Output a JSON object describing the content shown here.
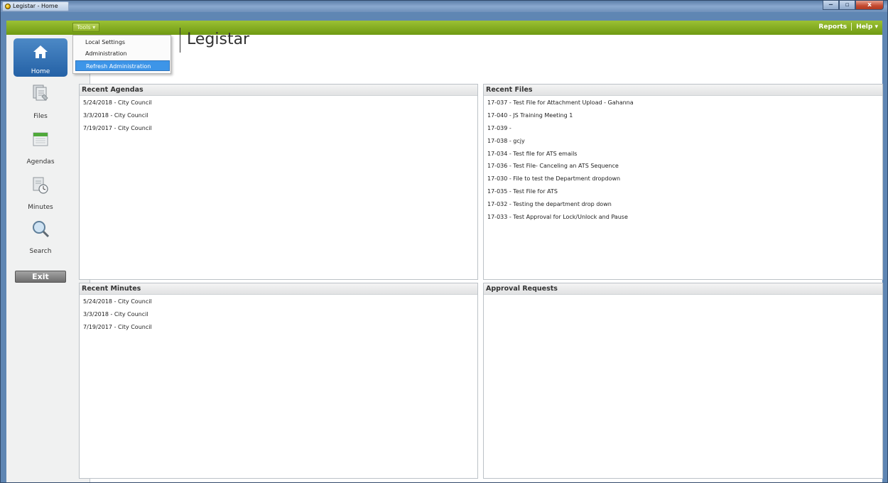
{
  "window": {
    "title": "Legistar - Home",
    "controls": {
      "minimize": "‒",
      "maximize": "▫",
      "close": "x"
    }
  },
  "menubar": {
    "tools_label": "Tools ▾",
    "reports_label": "Reports",
    "help_label": "Help ▾"
  },
  "tools_menu": {
    "items": [
      "Local Settings",
      "Administration",
      "Refresh Administration"
    ],
    "highlighted": "Refresh Administration"
  },
  "sidebar": {
    "items": [
      {
        "label": "Home",
        "icon": "home-icon",
        "active": true
      },
      {
        "label": "Files",
        "icon": "files-icon"
      },
      {
        "label": "Agendas",
        "icon": "calendar-icon"
      },
      {
        "label": "Minutes",
        "icon": "minutes-clock-icon"
      },
      {
        "label": "Search",
        "icon": "search-icon"
      }
    ],
    "exit_label": "Exit"
  },
  "header": {
    "app_title": "Legistar"
  },
  "panels": {
    "recent_agendas": {
      "title": "Recent Agendas",
      "items": [
        "5/24/2018 - City Council",
        "3/3/2018 - City Council",
        "7/19/2017 - City Council"
      ]
    },
    "recent_files": {
      "title": "Recent Files",
      "items": [
        "17-037 - Test File for Attachment Upload - Gahanna",
        "17-040 - JS Training Meeting 1",
        "17-039 -",
        "17-038 - gcjy",
        "17-034 - Test file for ATS emails",
        "17-036 - Test File- Canceling an ATS Sequence",
        "17-030 - File to test the Department dropdown",
        "17-035 - Test File for ATS",
        "17-032 - Testing the department drop down",
        "17-033 - Test Approval for Lock/Unlock and Pause"
      ]
    },
    "recent_minutes": {
      "title": "Recent Minutes",
      "items": [
        "5/24/2018 - City Council",
        "3/3/2018 - City Council",
        "7/19/2017 - City Council"
      ]
    },
    "approval_requests": {
      "title": "Approval Requests",
      "items": []
    }
  },
  "colors": {
    "accent_green": "#7ea51d",
    "home_active_blue": "#2f6db0",
    "menu_highlight_blue": "#3d95e8"
  }
}
